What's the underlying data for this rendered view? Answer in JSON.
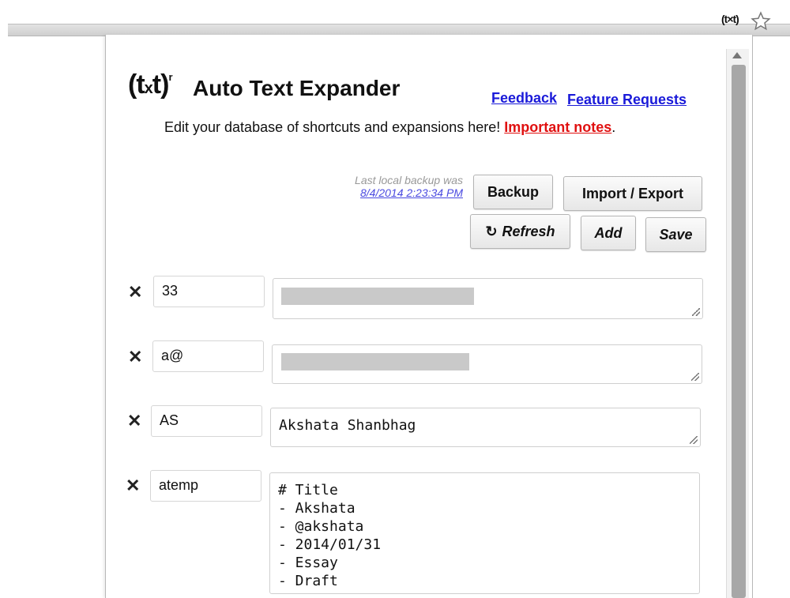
{
  "browser": {
    "extension_icon_label": "(t×t)",
    "bookmark_icon": "star-icon"
  },
  "header": {
    "logo_text": "(t",
    "logo_x": "x",
    "logo_end": "t)",
    "logo_sup": "r",
    "title": "Auto Text Expander",
    "feedback_link": "Feedback",
    "feature_link": "Feature Requests"
  },
  "intro": {
    "text": "Edit your database of shortcuts and expansions here! ",
    "important_link": "Important notes",
    "period": "."
  },
  "backup": {
    "label": "Last local backup was",
    "date": "8/4/2014 2:23:34 PM"
  },
  "buttons": {
    "backup": "Backup",
    "import_export": "Import / Export",
    "refresh": "Refresh",
    "add": "Add",
    "save": "Save"
  },
  "entries": [
    {
      "shortcut": "33",
      "expansion": ""
    },
    {
      "shortcut": "a@",
      "expansion": ""
    },
    {
      "shortcut": "AS",
      "expansion": "Akshata Shanbhag"
    },
    {
      "shortcut": "atemp",
      "expansion": "# Title\n- Akshata\n- @akshata\n- 2014/01/31\n- Essay\n- Draft"
    }
  ],
  "colors": {
    "link_blue": "#1a1ad9",
    "notes_red": "#e01010",
    "backup_date": "#4a4ae0"
  }
}
